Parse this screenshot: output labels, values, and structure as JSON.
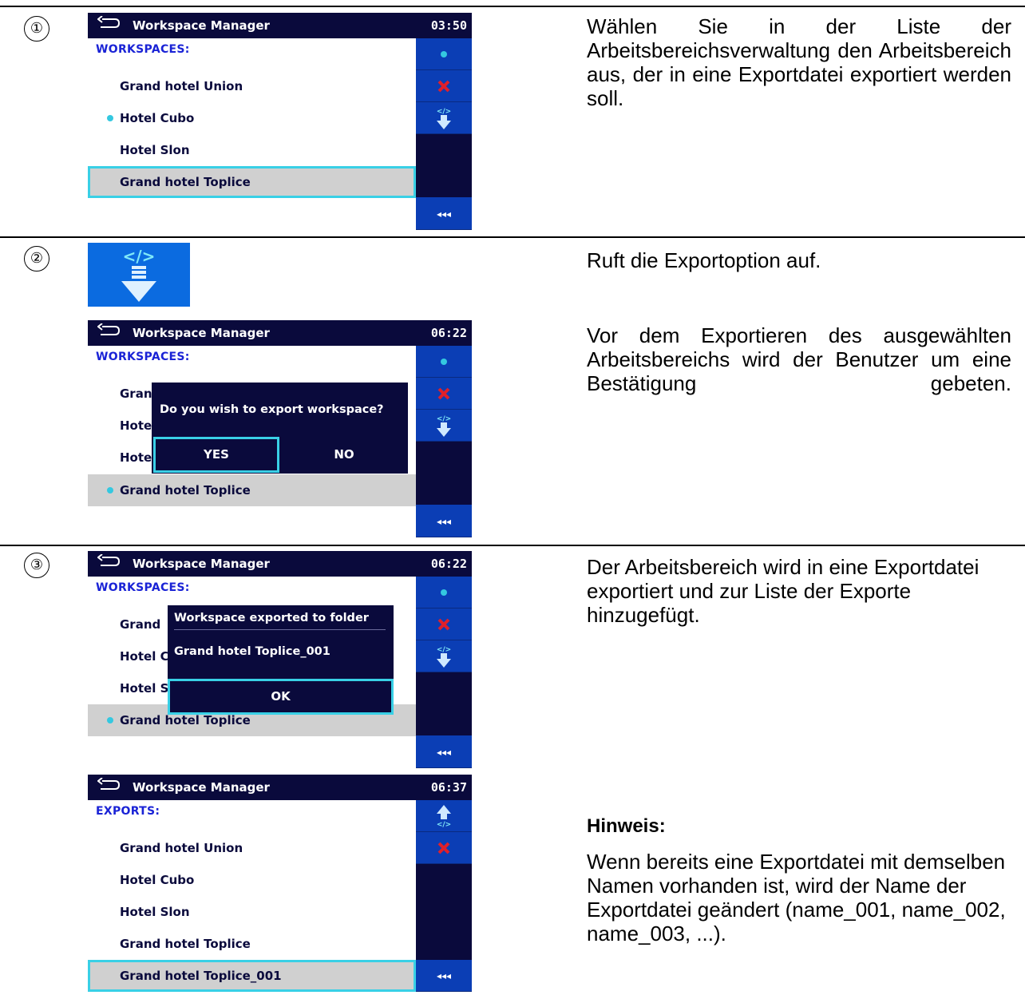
{
  "steps": [
    {
      "number": "①",
      "description": "Wählen Sie in der Liste der Arbeitsbereichsverwaltung den Arbeitsbereich aus, der in eine Exportdatei exportiert werden soll."
    },
    {
      "number": "②",
      "description_a": "Ruft die Exportoption auf.",
      "description_b": "Vor dem Exportieren des ausgewählten Arbeitsbereichs wird der Benutzer um eine Bestätigung gebeten."
    },
    {
      "number": "③",
      "description": "Der Arbeitsbereich wird in eine Exportdatei exportiert und zur Liste der Exporte hinzugefügt.",
      "note_heading": "Hinweis:",
      "note_text": "Wenn bereits eine Exportdatei mit demselben Namen vorhanden ist, wird der Name der Exportdatei geändert (name_001, name_002, name_003, ...)."
    }
  ],
  "screen1": {
    "title": "Workspace Manager",
    "time": "03:50",
    "section": "WORKSPACES:",
    "items": [
      "Grand hotel Union",
      "Hotel Cubo",
      "Hotel Slon",
      "Grand hotel Toplice"
    ],
    "sidebar_more": "◂◂◂"
  },
  "screen2": {
    "title": "Workspace Manager",
    "time": "06:22",
    "section": "WORKSPACES:",
    "items_partial": [
      "Gran",
      "Hote",
      "Hote"
    ],
    "selected_item": "Grand hotel Toplice",
    "dialog_question": "Do you wish to export workspace?",
    "yes": "YES",
    "no": "NO",
    "sidebar_more": "◂◂◂"
  },
  "screen3": {
    "title": "Workspace Manager",
    "time": "06:22",
    "section": "WORKSPACES:",
    "items_partial": [
      "Grand",
      "Hotel C",
      "Hotel S"
    ],
    "selected_item": "Grand hotel Toplice",
    "dialog_title": "Workspace exported to folder",
    "dialog_folder": "Grand hotel Toplice_001",
    "ok": "OK",
    "sidebar_more": "◂◂◂"
  },
  "screen4": {
    "title": "Workspace Manager",
    "time": "06:37",
    "section": "EXPORTS:",
    "items": [
      "Grand hotel Union",
      "Hotel Cubo",
      "Hotel Slon",
      "Grand hotel Toplice",
      "Grand hotel Toplice_001"
    ],
    "sidebar_more": "◂◂◂"
  },
  "colors": {
    "titlebar": "#0a0a3c",
    "sidebar_button": "#0b3eb5",
    "focus": "#39d0e6",
    "section_text": "#1a23d6",
    "delete_red": "#e0202a"
  }
}
